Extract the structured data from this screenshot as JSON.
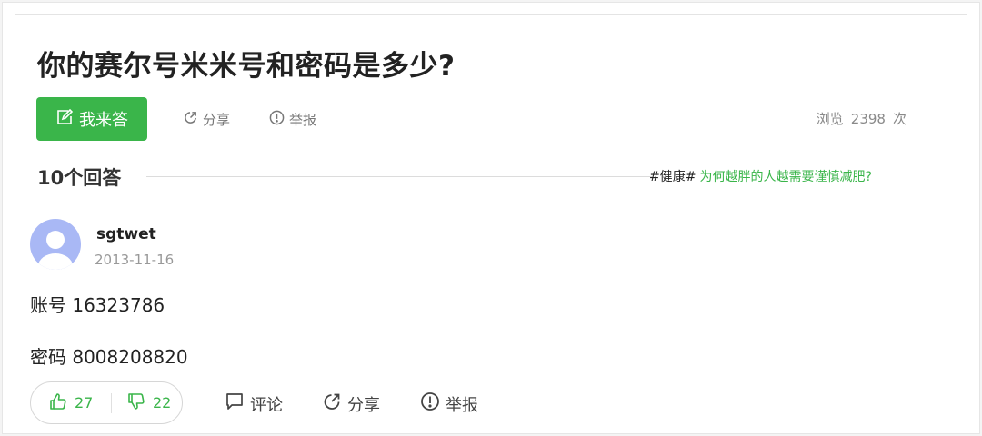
{
  "question": {
    "title": "你的赛尔号米米号和密码是多少?",
    "answer_button_label": "我来答",
    "share_label": "分享",
    "report_label": "举报",
    "views_prefix": "浏览",
    "views_count": "2398",
    "views_suffix": "次"
  },
  "answers_header": {
    "count_label": "10个回答",
    "topic_tag": "#健康#",
    "topic_link": "为何越胖的人越需要谨慎减肥?"
  },
  "answer": {
    "username": "sgtwet",
    "date": "2013-11-16",
    "lines": [
      "账号 16323786",
      "密码 8008208820"
    ],
    "upvotes": "27",
    "downvotes": "22",
    "comment_label": "评论",
    "share_label": "分享",
    "report_label": "举报"
  },
  "colors": {
    "accent_green": "#3ab54a",
    "avatar_bg": "#a9b8f5"
  },
  "icons": [
    "edit-icon",
    "share-icon",
    "report-icon",
    "thumbs-up-icon",
    "thumbs-down-icon",
    "comment-icon",
    "avatar-icon"
  ]
}
